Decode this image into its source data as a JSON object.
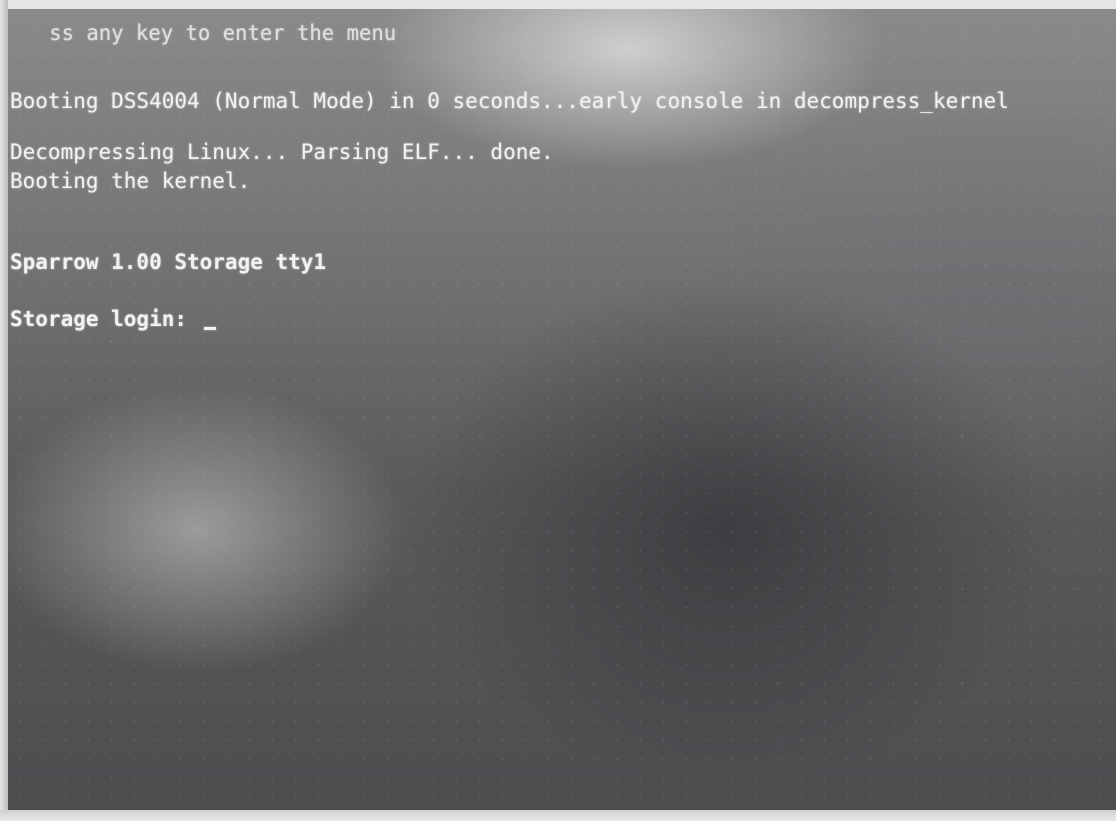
{
  "console": {
    "line1": "ss any key to enter the menu",
    "line2": "Booting DSS4004 (Normal Mode) in 0 seconds...early console in decompress_kernel",
    "line3": "Decompressing Linux... Parsing ELF... done.",
    "line4": "Booting the kernel.",
    "line5": "Sparrow 1.00 Storage tty1",
    "login_prompt": "Storage login: "
  }
}
